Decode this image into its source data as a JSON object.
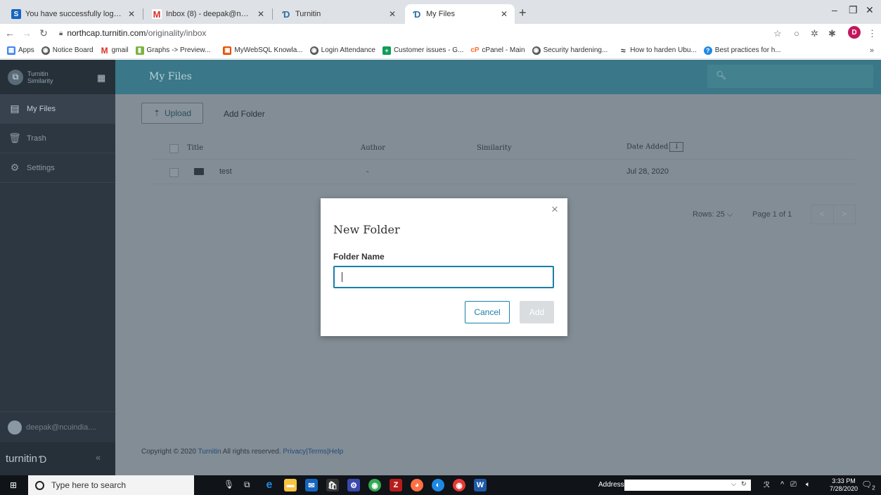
{
  "browser": {
    "tabs": [
      {
        "label": "You have successfully logged in.",
        "favicon": "S",
        "color": "#1565c0"
      },
      {
        "label": "Inbox (8) - deepak@ncuindia.edu",
        "favicon": "M",
        "color": "#d93025"
      },
      {
        "label": "Turnitin",
        "favicon": "turnitin-icon",
        "color": "#2a6ea3"
      },
      {
        "label": "My Files",
        "favicon": "turnitin-icon",
        "color": "#2a6ea3"
      }
    ],
    "new_tab": "+",
    "url_host": "northcap.turnitin.com",
    "url_path": "/originality/inbox",
    "profile_initial": "D",
    "bookmarks": [
      {
        "label": "Apps"
      },
      {
        "label": "Notice Board"
      },
      {
        "label": "gmail"
      },
      {
        "label": "Graphs -> Preview..."
      },
      {
        "label": "MyWebSQL Knowla..."
      },
      {
        "label": "Login Attendance"
      },
      {
        "label": "Customer issues - G..."
      },
      {
        "label": "cPanel - Main"
      },
      {
        "label": "Security hardening..."
      },
      {
        "label": "How to harden Ubu..."
      },
      {
        "label": "Best practices for h..."
      }
    ],
    "bookmarks_more": "»"
  },
  "sidebar": {
    "brand_line1": "Turnitin",
    "brand_line2": "Similarity",
    "items": [
      {
        "label": "My Files",
        "icon": "files-icon"
      },
      {
        "label": "Trash",
        "icon": "trash-icon"
      },
      {
        "label": "Settings",
        "icon": "gear-icon"
      }
    ],
    "user": "deepak@ncuindia....",
    "logo_text": "turnitin",
    "collapse": "«"
  },
  "header": {
    "title": "My Files"
  },
  "toolbar": {
    "upload_label": "Upload",
    "add_folder_label": "Add Folder"
  },
  "table": {
    "columns": {
      "title": "Title",
      "author": "Author",
      "similarity": "Similarity",
      "date_added": "Date Added"
    },
    "rows": [
      {
        "title": "test",
        "author": "-",
        "similarity": "",
        "date_added": "Jul 28, 2020"
      }
    ]
  },
  "pagination": {
    "rows_label": "Rows: 25",
    "page_label": "Page 1 of 1",
    "prev": "<",
    "next": ">"
  },
  "footer": {
    "prefix": "Copyright © 2020",
    "brand": "Turnitin",
    "middle": "All rights reserved.",
    "privacy": "Privacy",
    "sep1": "|",
    "terms": "Terms",
    "sep2": "|",
    "help": "Help"
  },
  "modal": {
    "title": "New Folder",
    "field_label": "Folder Name",
    "field_value": "",
    "cancel_label": "Cancel",
    "add_label": "Add",
    "close": "×"
  },
  "taskbar": {
    "search_placeholder": "Type here to search",
    "address_label": "Address",
    "time": "3:33 PM",
    "date": "7/28/2020",
    "notifications": "2"
  },
  "colors": {
    "app_header": "#3a7788",
    "sidebar": "#2d3741",
    "accent": "#1a7fa9",
    "overlay_content": "#838d95"
  }
}
